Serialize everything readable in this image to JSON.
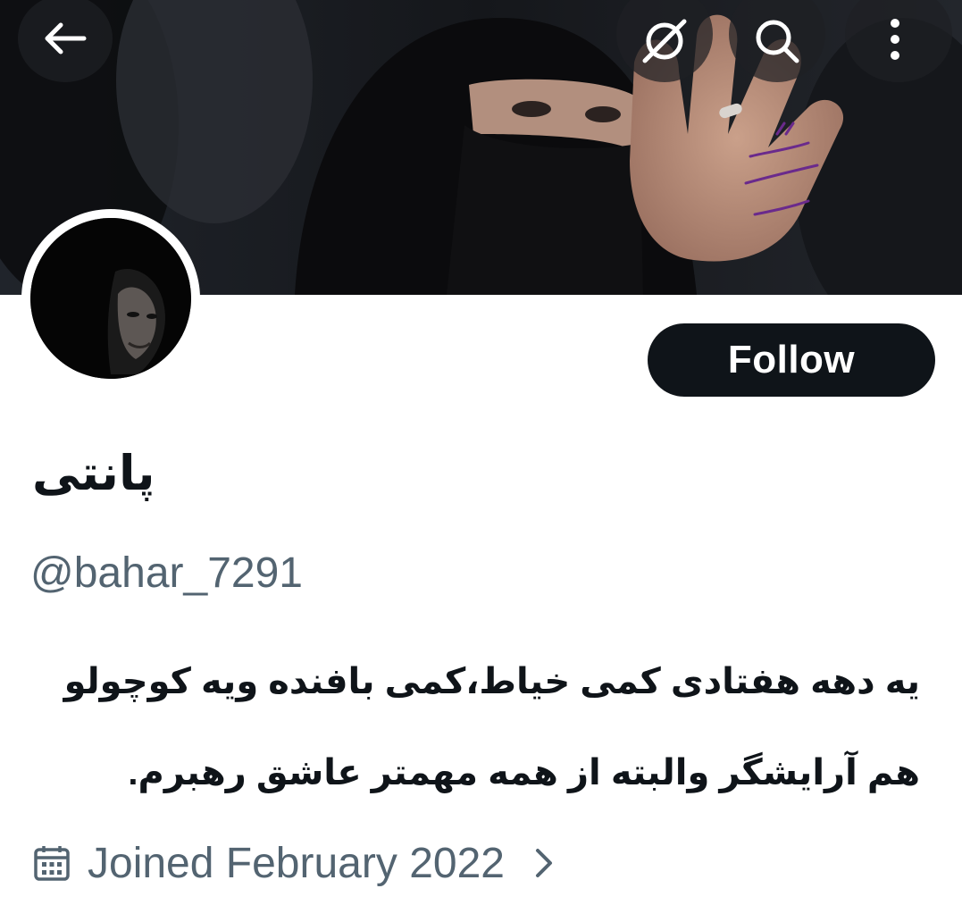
{
  "header": {
    "back_icon": "arrow-left-icon",
    "translate_icon": "translate-off-icon",
    "search_icon": "search-icon",
    "more_icon": "more-vertical-icon"
  },
  "profile": {
    "display_name": "پانتی",
    "handle": "@bahar_7291",
    "follow_label": "Follow",
    "bio_lines": [
      "یه دهه هفتادی کمی خیاط،کمی بافنده ویه کوچولو",
      "هم آرایشگر والبته از همه مهمتر عاشق رهبرم."
    ],
    "joined": "Joined February 2022"
  },
  "banner_hand_text": [
    "#لبیک",
    "یا امام خامنه",
    "#انقلابی_ام"
  ],
  "colors": {
    "text_primary": "#0f1419",
    "text_secondary": "#536471",
    "follow_bg": "#0f1419",
    "follow_text": "#ffffff",
    "hand_ink": "#6a2a8c"
  }
}
